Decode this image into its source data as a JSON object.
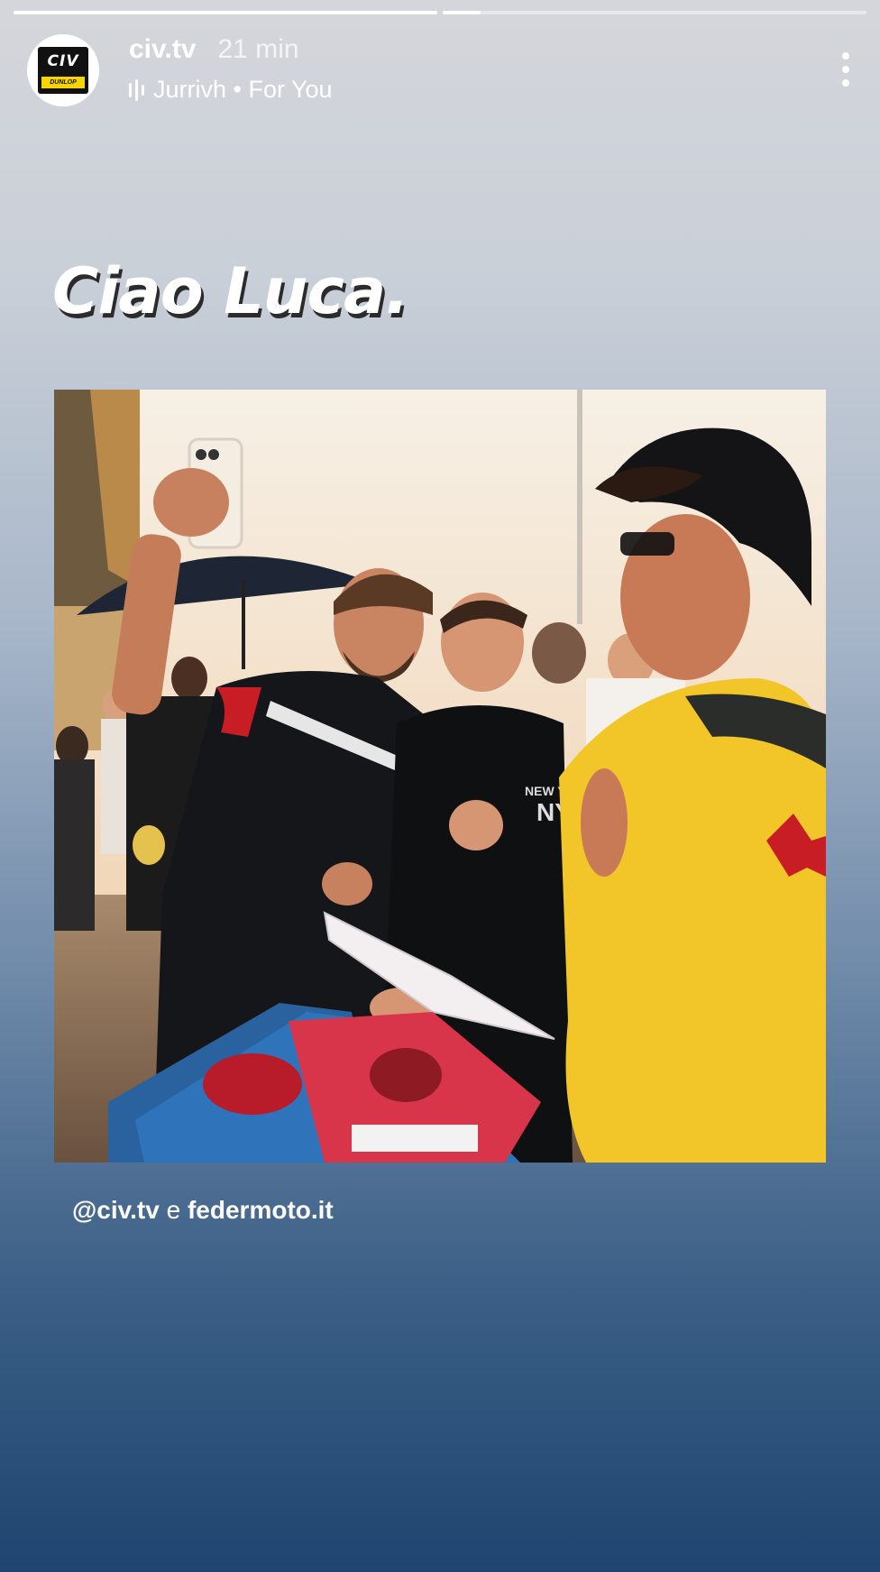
{
  "progress": [
    {
      "state": "complete",
      "fill": 1.0
    },
    {
      "state": "current",
      "fill": 0.09
    }
  ],
  "header": {
    "username": "civ.tv",
    "time": "21 min",
    "audio": "Jurrivh • For You",
    "avatar_logo_text": "CIV",
    "avatar_logo_sub": "DUNLOP"
  },
  "story": {
    "headline": "Ciao Luca.",
    "caption_mention": "@civ.tv",
    "caption_and": "e",
    "caption_site": "federmoto.it"
  },
  "icons": {
    "audio": "audio-wave-icon",
    "more": "more-vertical-icon"
  },
  "colors": {
    "gradient_top": "#d4d6db",
    "gradient_bottom": "#1f4570",
    "text": "#ffffff",
    "logo_yellow": "#f5d400"
  }
}
